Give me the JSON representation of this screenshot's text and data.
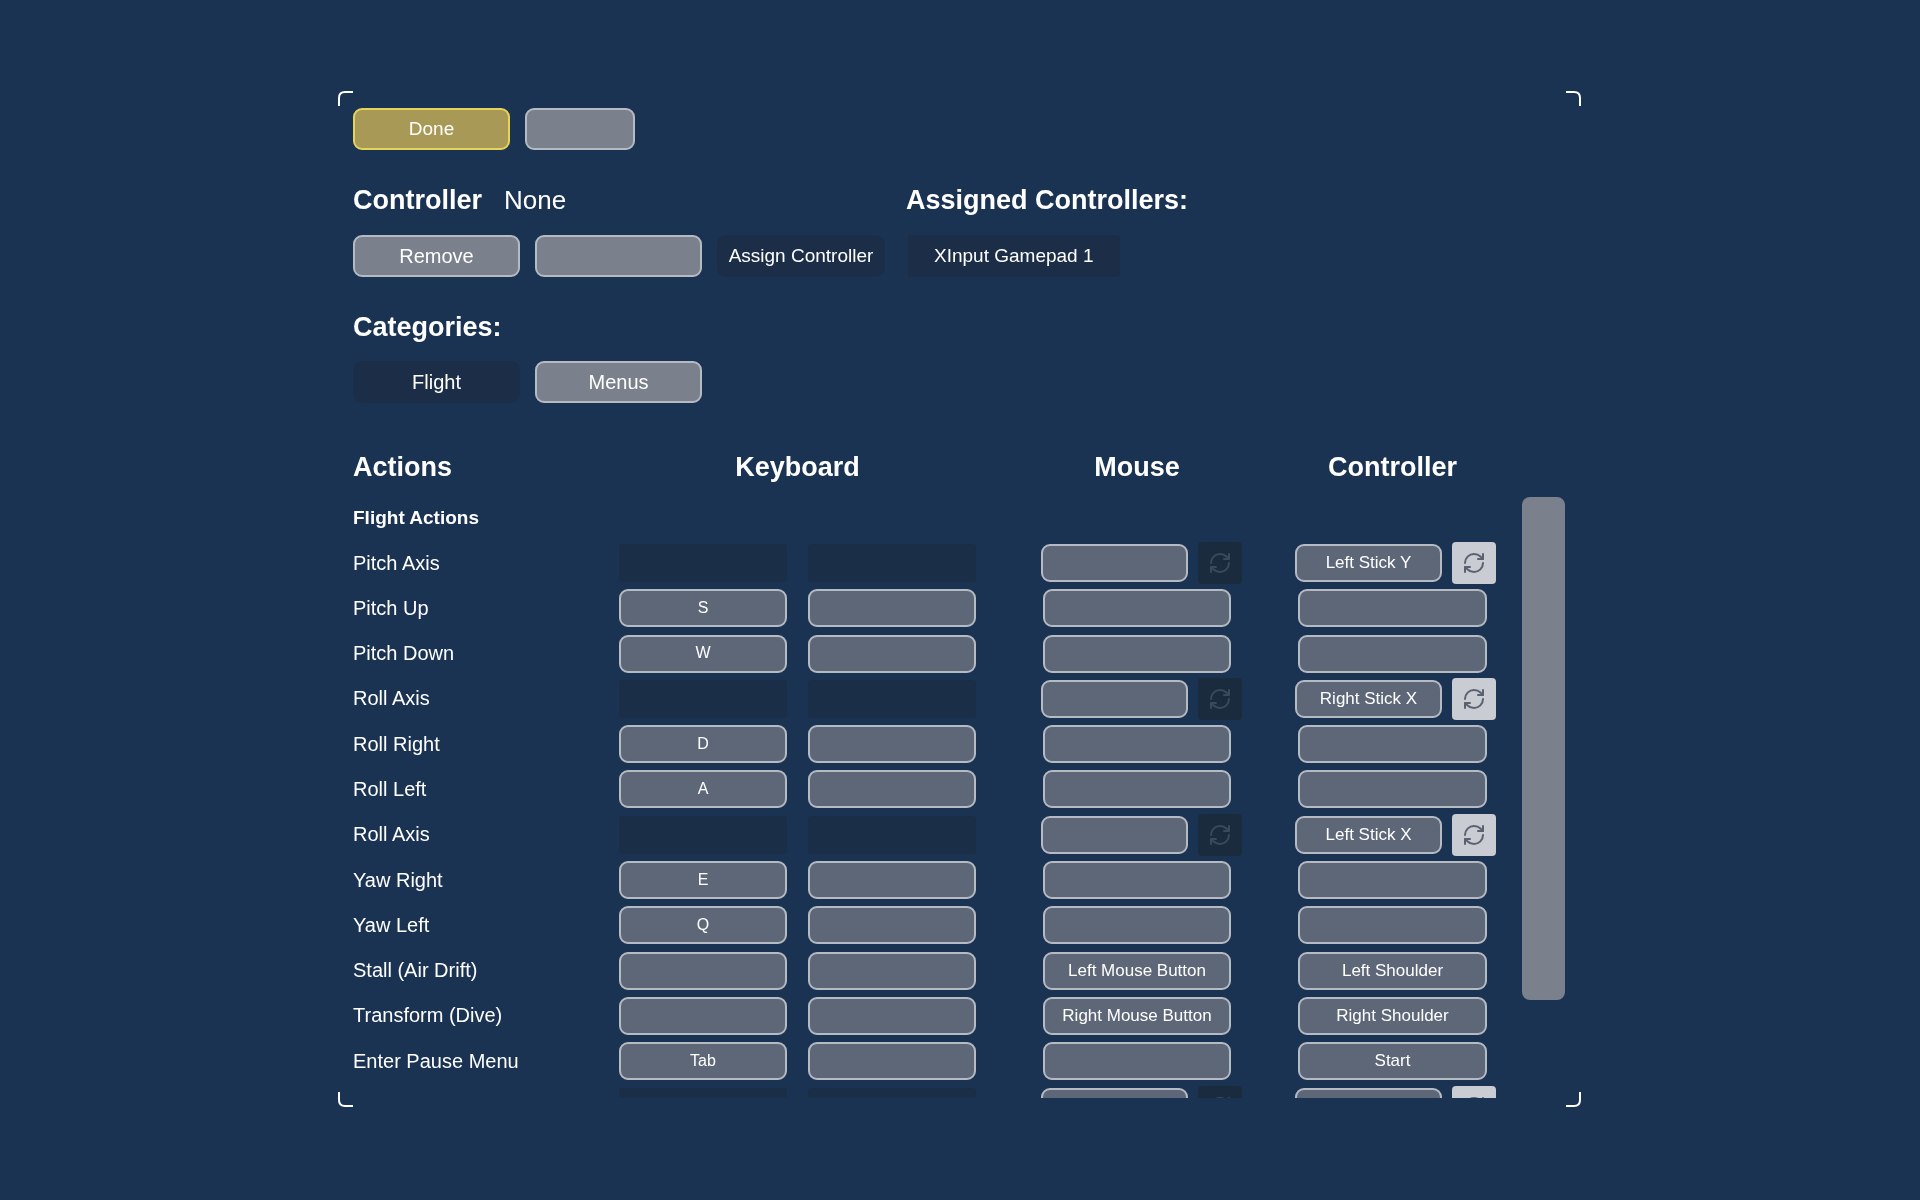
{
  "top_buttons": [
    {
      "label": "Done",
      "highlighted": true
    },
    {
      "highlighted": false
    }
  ],
  "controller": {
    "label": "Controller",
    "value": "None",
    "buttons": [
      "Remove"
    ],
    "assign": "Assign Controller"
  },
  "assigned": {
    "title": "Assigned Controllers:",
    "items": [
      "XInput Gamepad 1"
    ]
  },
  "categories": {
    "title": "Categories:",
    "tabs": [
      {
        "label": "Flight",
        "selected": true
      },
      {
        "label": "Menus",
        "selected": false
      }
    ]
  },
  "table": {
    "columns": [
      "Actions",
      "Keyboard",
      "Mouse",
      "Controller"
    ],
    "section": "Flight Actions",
    "rows": [
      {
        "kind": "axis",
        "label": "Pitch Axis",
        "controller": "Left Stick Y",
        "mouse_inverted": false,
        "controller_inverted": true
      },
      {
        "kind": "button",
        "label": "Pitch Up",
        "key_1": "S"
      },
      {
        "kind": "button",
        "label": "Pitch Down",
        "key_1": "W"
      },
      {
        "kind": "axis",
        "label": "Roll Axis",
        "controller": "Right Stick X",
        "mouse_inverted": false,
        "controller_inverted": true
      },
      {
        "kind": "button",
        "label": "Roll Right",
        "key_1": "D"
      },
      {
        "kind": "button",
        "label": "Roll Left",
        "key_1": "A"
      },
      {
        "kind": "axis",
        "label": "Roll Axis",
        "controller": "Left Stick X",
        "mouse_inverted": false,
        "controller_inverted": true
      },
      {
        "kind": "button",
        "label": "Yaw Right",
        "key_1": "E"
      },
      {
        "kind": "button",
        "label": "Yaw Left",
        "key_1": "Q"
      },
      {
        "kind": "button",
        "label": "Stall (Air Drift)",
        "mouse": "Left Mouse Button",
        "controller": "Left Shoulder"
      },
      {
        "kind": "button",
        "label": "Transform (Dive)",
        "mouse": "Right Mouse Button",
        "controller": "Right Shoulder"
      },
      {
        "kind": "button",
        "label": "Enter Pause Menu",
        "key_1": "Tab",
        "controller": "Start"
      },
      {
        "kind": "axis",
        "mouse_inverted": false,
        "controller_inverted": true
      }
    ]
  }
}
